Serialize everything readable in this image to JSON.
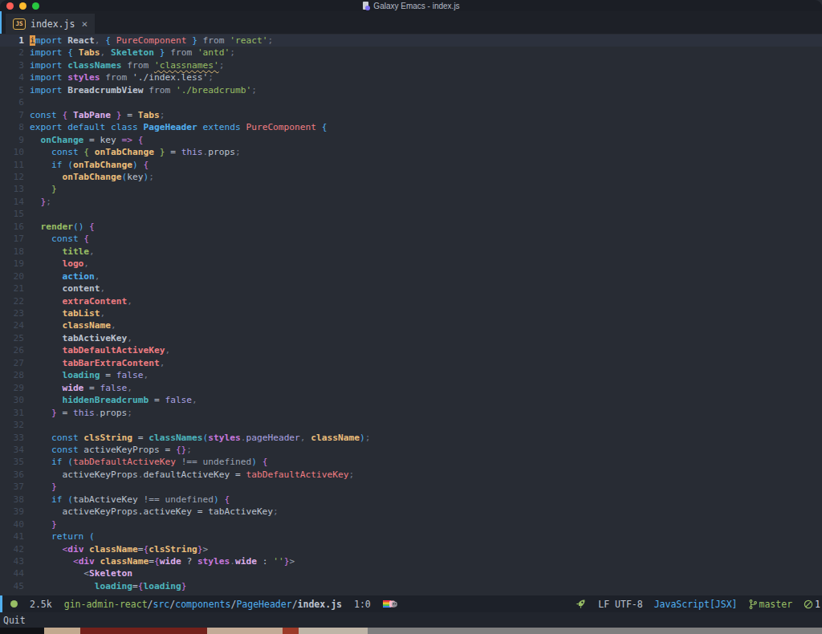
{
  "titlebar": {
    "title": "Galaxy Emacs - index.js"
  },
  "tab": {
    "icon": "JS",
    "label": "index.js",
    "close": "×"
  },
  "echo": {
    "text": "Quit"
  },
  "modeline": {
    "size": "2.5k",
    "path_segments": [
      [
        "grn",
        "gin-admin-react"
      ],
      [
        "fg",
        "/"
      ],
      [
        "blu",
        "src"
      ],
      [
        "fg",
        "/"
      ],
      [
        "blu",
        "components"
      ],
      [
        "fg",
        "/"
      ],
      [
        "blu",
        "PageHeader"
      ],
      [
        "fg",
        "/"
      ],
      [
        "fgb",
        "index.js"
      ]
    ],
    "cursor_pos": "1:0",
    "encoding": "LF UTF-8",
    "mode": "JavaScript[JSX]",
    "branch": "master",
    "issue_count": "1",
    "accent_color": "#51afef",
    "ok_color": "#98be65"
  },
  "code": {
    "palette": {
      "kw": {
        "c": "#51afef"
      },
      "fg": {
        "c": "#bbc2cf"
      },
      "fgb": {
        "c": "#bbc2cf",
        "b": 1
      },
      "pun": {
        "c": "#70788a"
      },
      "frm": {
        "c": "#9da5b5"
      },
      "str": {
        "c": "#98be65"
      },
      "stru": {
        "c": "#98be65",
        "u": 1
      },
      "red": {
        "c": "#ee7d82"
      },
      "redb": {
        "c": "#ee7d82",
        "b": 1
      },
      "yel": {
        "c": "#ecbe7b"
      },
      "yelb": {
        "c": "#ecbe7b",
        "b": 1
      },
      "tea": {
        "c": "#4db5bd"
      },
      "teab": {
        "c": "#4db5bd",
        "b": 1
      },
      "mag": {
        "c": "#c678dd"
      },
      "magb": {
        "c": "#c678dd",
        "b": 1
      },
      "pink": {
        "c": "#dcaeea"
      },
      "pinkb": {
        "c": "#dcaeea",
        "b": 1
      },
      "vio": {
        "c": "#a9a1e1"
      },
      "grn": {
        "c": "#98be65"
      },
      "grnb": {
        "c": "#98be65",
        "b": 1
      },
      "blu": {
        "c": "#51afef"
      },
      "blub": {
        "c": "#51afef",
        "b": 1
      },
      "dim": {
        "c": "#9aa2b2"
      },
      "cursor": {
        "c": "#282c34",
        "bg": "#e29a49"
      }
    },
    "lines": [
      {
        "n": 1,
        "cur": 1,
        "t": [
          [
            "cursor",
            "i"
          ],
          [
            "kw",
            "mport"
          ],
          [
            "fgb",
            " React"
          ],
          [
            "pun",
            ","
          ],
          [
            "blu",
            " { "
          ],
          [
            "red",
            "PureComponent"
          ],
          [
            "blu",
            " }"
          ],
          [
            "frm",
            " from "
          ],
          [
            "str",
            "'react'"
          ],
          [
            "pun",
            ";"
          ]
        ]
      },
      {
        "n": 2,
        "t": [
          [
            "kw",
            "import"
          ],
          [
            "blu",
            " { "
          ],
          [
            "yelb",
            "Tabs"
          ],
          [
            "pun",
            ","
          ],
          [
            "teab",
            " Skeleton"
          ],
          [
            "blu",
            " }"
          ],
          [
            "frm",
            " from "
          ],
          [
            "str",
            "'antd'"
          ],
          [
            "pun",
            ";"
          ]
        ]
      },
      {
        "n": 3,
        "t": [
          [
            "kw",
            "import"
          ],
          [
            "teab",
            " classNames"
          ],
          [
            "frm",
            " from "
          ],
          [
            "stru",
            "'classnames'"
          ],
          [
            "pun",
            ";"
          ]
        ]
      },
      {
        "n": 4,
        "t": [
          [
            "kw",
            "import"
          ],
          [
            "magb",
            " styles"
          ],
          [
            "frm",
            " from "
          ],
          [
            "fg",
            "'./index.less'"
          ],
          [
            "pun",
            ";"
          ]
        ]
      },
      {
        "n": 5,
        "t": [
          [
            "kw",
            "import"
          ],
          [
            "fgb",
            " BreadcrumbView"
          ],
          [
            "frm",
            " from "
          ],
          [
            "str",
            "'./breadcrumb'"
          ],
          [
            "pun",
            ";"
          ]
        ]
      },
      {
        "n": 6,
        "t": []
      },
      {
        "n": 7,
        "t": [
          [
            "kw",
            "const"
          ],
          [
            "mag",
            " { "
          ],
          [
            "pinkb",
            "TabPane"
          ],
          [
            "mag",
            " }"
          ],
          [
            "fg",
            " = "
          ],
          [
            "yelb",
            "Tabs"
          ],
          [
            "pun",
            ";"
          ]
        ]
      },
      {
        "n": 8,
        "t": [
          [
            "kw",
            "export default class"
          ],
          [
            "blub",
            " PageHeader"
          ],
          [
            "kw",
            " extends"
          ],
          [
            "red",
            " PureComponent"
          ],
          [
            "blu",
            " {"
          ]
        ]
      },
      {
        "n": 9,
        "t": [
          [
            "teab",
            "  onChange"
          ],
          [
            "fg",
            " = key "
          ],
          [
            "mag",
            "=> {"
          ]
        ]
      },
      {
        "n": 10,
        "t": [
          [
            "kw",
            "    const"
          ],
          [
            "grn",
            " { "
          ],
          [
            "yelb",
            "onTabChange"
          ],
          [
            "grn",
            " }"
          ],
          [
            "fg",
            " = "
          ],
          [
            "vio",
            "this"
          ],
          [
            "pun",
            "."
          ],
          [
            "fg",
            "props"
          ],
          [
            "pun",
            ";"
          ]
        ]
      },
      {
        "n": 11,
        "t": [
          [
            "kw",
            "    if"
          ],
          [
            "blu",
            " ("
          ],
          [
            "yelb",
            "onTabChange"
          ],
          [
            "blu",
            ")"
          ],
          [
            "mag",
            " {"
          ]
        ]
      },
      {
        "n": 12,
        "t": [
          [
            "yelb",
            "      onTabChange"
          ],
          [
            "blu",
            "("
          ],
          [
            "fg",
            "key"
          ],
          [
            "blu",
            ")"
          ],
          [
            "pun",
            ";"
          ]
        ]
      },
      {
        "n": 13,
        "t": [
          [
            "grn",
            "    }"
          ]
        ]
      },
      {
        "n": 14,
        "t": [
          [
            "mag",
            "  }"
          ],
          [
            "pun",
            ";"
          ]
        ]
      },
      {
        "n": 15,
        "t": []
      },
      {
        "n": 16,
        "t": [
          [
            "grnb",
            "  render"
          ],
          [
            "blu",
            "()"
          ],
          [
            "mag",
            " {"
          ]
        ]
      },
      {
        "n": 17,
        "t": [
          [
            "kw",
            "    const"
          ],
          [
            "mag",
            " {"
          ]
        ]
      },
      {
        "n": 18,
        "t": [
          [
            "grnb",
            "      title"
          ],
          [
            "pun",
            ","
          ]
        ]
      },
      {
        "n": 19,
        "t": [
          [
            "redb",
            "      logo"
          ],
          [
            "pun",
            ","
          ]
        ]
      },
      {
        "n": 20,
        "t": [
          [
            "blub",
            "      action"
          ],
          [
            "pun",
            ","
          ]
        ]
      },
      {
        "n": 21,
        "t": [
          [
            "fgb",
            "      content"
          ],
          [
            "pun",
            ","
          ]
        ]
      },
      {
        "n": 22,
        "t": [
          [
            "redb",
            "      extraContent"
          ],
          [
            "pun",
            ","
          ]
        ]
      },
      {
        "n": 23,
        "t": [
          [
            "yelb",
            "      tabList"
          ],
          [
            "pun",
            ","
          ]
        ]
      },
      {
        "n": 24,
        "t": [
          [
            "yelb",
            "      className"
          ],
          [
            "pun",
            ","
          ]
        ]
      },
      {
        "n": 25,
        "t": [
          [
            "fgb",
            "      tabActiveKey"
          ],
          [
            "pun",
            ","
          ]
        ]
      },
      {
        "n": 26,
        "t": [
          [
            "redb",
            "      tabDefaultActiveKey"
          ],
          [
            "pun",
            ","
          ]
        ]
      },
      {
        "n": 27,
        "t": [
          [
            "redb",
            "      tabBarExtraContent"
          ],
          [
            "pun",
            ","
          ]
        ]
      },
      {
        "n": 28,
        "t": [
          [
            "teab",
            "      loading"
          ],
          [
            "fg",
            " = "
          ],
          [
            "vio",
            "false"
          ],
          [
            "pun",
            ","
          ]
        ]
      },
      {
        "n": 29,
        "t": [
          [
            "pinkb",
            "      wide"
          ],
          [
            "fg",
            " = "
          ],
          [
            "vio",
            "false"
          ],
          [
            "pun",
            ","
          ]
        ]
      },
      {
        "n": 30,
        "t": [
          [
            "teab",
            "      hiddenBreadcrumb"
          ],
          [
            "fg",
            " = "
          ],
          [
            "vio",
            "false"
          ],
          [
            "pun",
            ","
          ]
        ]
      },
      {
        "n": 31,
        "t": [
          [
            "mag",
            "    }"
          ],
          [
            "fg",
            " = "
          ],
          [
            "vio",
            "this"
          ],
          [
            "pun",
            "."
          ],
          [
            "fg",
            "props"
          ],
          [
            "pun",
            ";"
          ]
        ]
      },
      {
        "n": 32,
        "t": []
      },
      {
        "n": 33,
        "t": [
          [
            "kw",
            "    const"
          ],
          [
            "yelb",
            " clsString"
          ],
          [
            "fg",
            " = "
          ],
          [
            "teab",
            "classNames"
          ],
          [
            "blu",
            "("
          ],
          [
            "magb",
            "styles"
          ],
          [
            "pun",
            "."
          ],
          [
            "vio",
            "pageHeader"
          ],
          [
            "pun",
            ","
          ],
          [
            "yelb",
            " className"
          ],
          [
            "blu",
            ")"
          ],
          [
            "pun",
            ";"
          ]
        ]
      },
      {
        "n": 34,
        "t": [
          [
            "kw",
            "    const"
          ],
          [
            "fg",
            " activeKeyProps = "
          ],
          [
            "mag",
            "{}"
          ],
          [
            "pun",
            ";"
          ]
        ]
      },
      {
        "n": 35,
        "t": [
          [
            "kw",
            "    if"
          ],
          [
            "blu",
            " ("
          ],
          [
            "red",
            "tabDefaultActiveKey"
          ],
          [
            "dim",
            " !== "
          ],
          [
            "dim",
            "undefined"
          ],
          [
            "blu",
            ")"
          ],
          [
            "mag",
            " {"
          ]
        ]
      },
      {
        "n": 36,
        "t": [
          [
            "fg",
            "      activeKeyProps"
          ],
          [
            "pun",
            "."
          ],
          [
            "fg",
            "defaultActiveKey = "
          ],
          [
            "red",
            "tabDefaultActiveKey"
          ],
          [
            "pun",
            ";"
          ]
        ]
      },
      {
        "n": 37,
        "t": [
          [
            "mag",
            "    }"
          ]
        ]
      },
      {
        "n": 38,
        "t": [
          [
            "kw",
            "    if"
          ],
          [
            "blu",
            " ("
          ],
          [
            "fg",
            "tabActiveKey"
          ],
          [
            "dim",
            " !== "
          ],
          [
            "dim",
            "undefined"
          ],
          [
            "blu",
            ")"
          ],
          [
            "mag",
            " {"
          ]
        ]
      },
      {
        "n": 39,
        "t": [
          [
            "fg",
            "      activeKeyProps.activeKey = tabActiveKey"
          ],
          [
            "pun",
            ";"
          ]
        ]
      },
      {
        "n": 40,
        "t": [
          [
            "mag",
            "    }"
          ]
        ]
      },
      {
        "n": 41,
        "t": [
          [
            "kw",
            "    return"
          ],
          [
            "blu",
            " ("
          ]
        ]
      },
      {
        "n": 42,
        "t": [
          [
            "mag",
            "      <"
          ],
          [
            "magb",
            "div"
          ],
          [
            "yelb",
            " className"
          ],
          [
            "fg",
            "="
          ],
          [
            "mag",
            "{"
          ],
          [
            "yelb",
            "clsString"
          ],
          [
            "mag",
            "}"
          ],
          [
            "dim",
            ">"
          ]
        ]
      },
      {
        "n": 43,
        "t": [
          [
            "mag",
            "        <"
          ],
          [
            "magb",
            "div"
          ],
          [
            "yelb",
            " className"
          ],
          [
            "fg",
            "="
          ],
          [
            "mag",
            "{"
          ],
          [
            "pinkb",
            "wide"
          ],
          [
            "fg",
            " ? "
          ],
          [
            "magb",
            "styles"
          ],
          [
            "pun",
            "."
          ],
          [
            "pinkb",
            "wide"
          ],
          [
            "fg",
            " : "
          ],
          [
            "str",
            "''"
          ],
          [
            "mag",
            "}"
          ],
          [
            "dim",
            ">"
          ]
        ]
      },
      {
        "n": 44,
        "t": [
          [
            "dim",
            "          <"
          ],
          [
            "pinkb",
            "Skeleton"
          ]
        ]
      },
      {
        "n": 45,
        "t": [
          [
            "teab",
            "            loading"
          ],
          [
            "fg",
            "="
          ],
          [
            "mag",
            "{"
          ],
          [
            "teab",
            "loading"
          ],
          [
            "mag",
            "}"
          ]
        ]
      }
    ]
  },
  "strip": {
    "stripes": [
      [
        0,
        55,
        "#111216"
      ],
      [
        55,
        45,
        "#c2a98f"
      ],
      [
        100,
        158,
        "#73211b"
      ],
      [
        258,
        94,
        "#c3ab97"
      ],
      [
        352,
        20,
        "#9c3a28"
      ],
      [
        372,
        86,
        "#bfb5a7"
      ],
      [
        458,
        566,
        "#7f7f7f"
      ]
    ]
  }
}
